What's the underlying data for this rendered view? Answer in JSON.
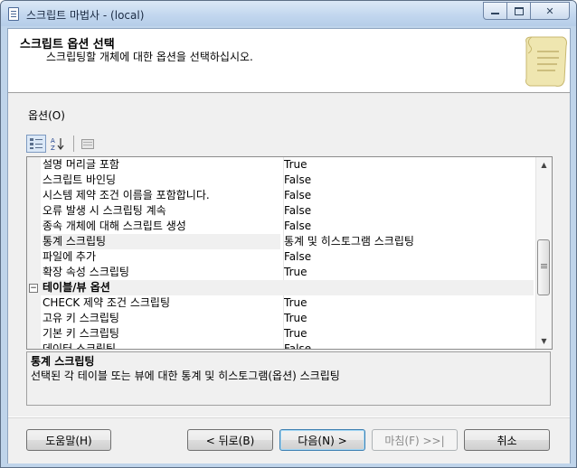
{
  "window": {
    "title": "스크립트 마법사 - (local)",
    "minimize_glyph": "▭",
    "restore_glyph": "▣",
    "close_glyph": "✕"
  },
  "header": {
    "title": "스크립트 옵션 선택",
    "subtitle": "스크립팅할 개체에 대한 옵션을 선택하십시오."
  },
  "options_label": "옵션(O)",
  "toolbar": {
    "categorized_icon": "categorized-icon",
    "sort_az_label": "A↓Z",
    "pages_icon": "property-pages-icon"
  },
  "grid": {
    "rows": [
      {
        "type": "prop",
        "name": "설명 머리글 포함",
        "value": "True"
      },
      {
        "type": "prop",
        "name": "스크립트 바인딩",
        "value": "False"
      },
      {
        "type": "prop",
        "name": "시스템 제약 조건 이름을 포함합니다.",
        "value": "False"
      },
      {
        "type": "prop",
        "name": "오류 발생 시 스크립팅 계속",
        "value": "False"
      },
      {
        "type": "prop",
        "name": "종속 개체에 대해 스크립트 생성",
        "value": "False"
      },
      {
        "type": "prop",
        "name": "통계 스크립팅",
        "value": "통계 및 히스토그램 스크립팅",
        "selected": true
      },
      {
        "type": "prop",
        "name": "파일에 추가",
        "value": "False"
      },
      {
        "type": "prop",
        "name": "확장 속성 스크립팅",
        "value": "True"
      },
      {
        "type": "cat",
        "name": "테이블/뷰 옵션",
        "expander": "−"
      },
      {
        "type": "prop",
        "name": "CHECK 제약 조건 스크립팅",
        "value": "True"
      },
      {
        "type": "prop",
        "name": "고유 키 스크립팅",
        "value": "True"
      },
      {
        "type": "prop",
        "name": "기본 키 스크립팅",
        "value": "True"
      },
      {
        "type": "prop",
        "name": "데이터 스크립팅",
        "value": "False"
      }
    ],
    "scroll_up": "▲",
    "scroll_down": "▼"
  },
  "description": {
    "title": "통계 스크립팅",
    "text": "선택된 각 테이블 또는 뷰에 대한 통계 및 히스토그램(옵션) 스크립팅"
  },
  "buttons": {
    "help": "도움말(H)",
    "back": "< 뒤로(B)",
    "next": "다음(N) >",
    "finish": "마침(F) >>|",
    "cancel": "취소"
  }
}
